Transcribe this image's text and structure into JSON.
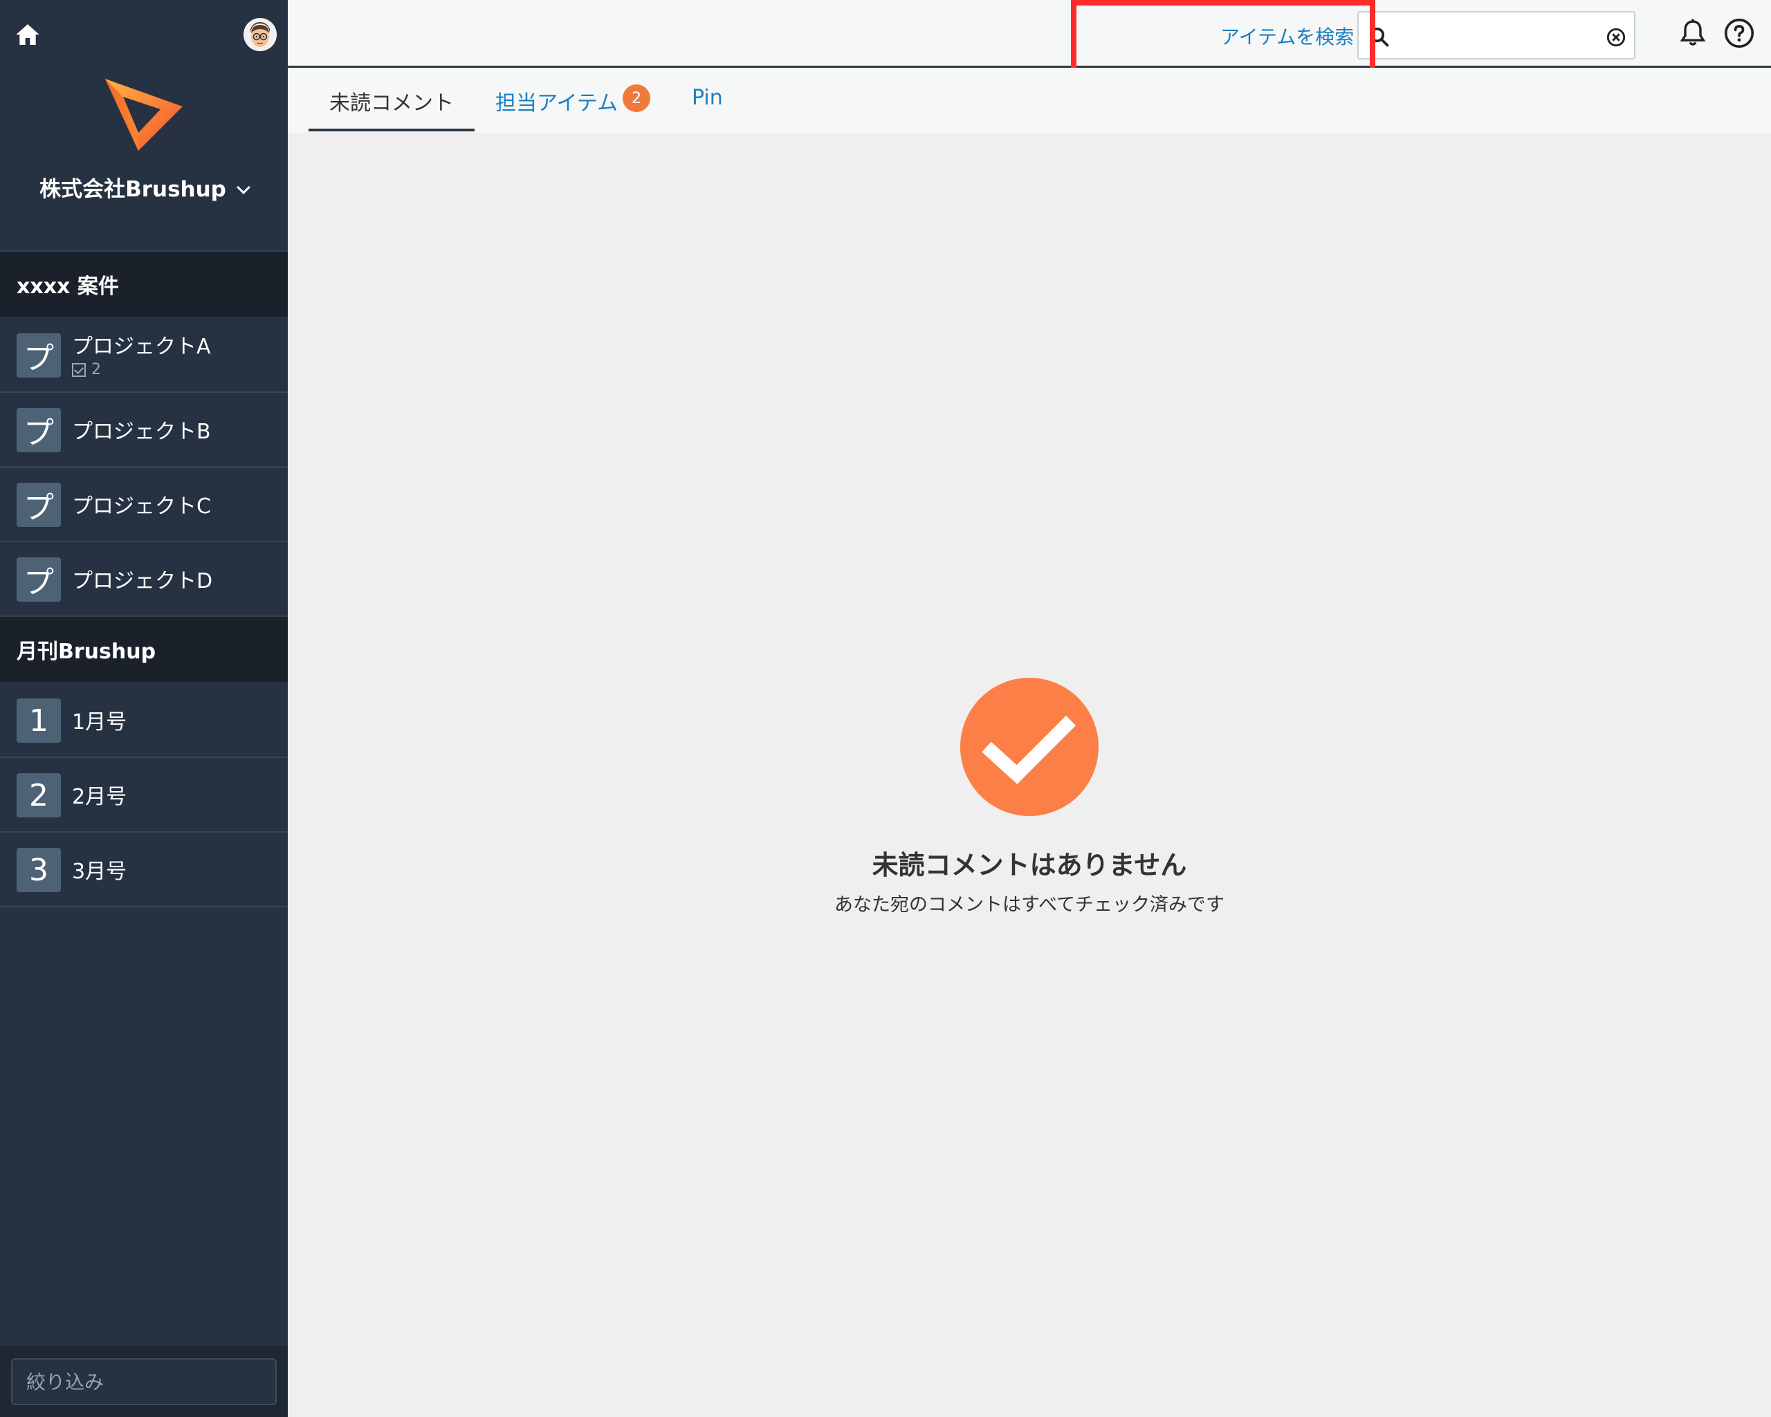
{
  "sidebar": {
    "org_name": "株式会社Brushup",
    "groups": [
      {
        "title": "xxxx 案件",
        "items": [
          {
            "icon": "プ",
            "label": "プロジェクトA",
            "count": "2"
          },
          {
            "icon": "プ",
            "label": "プロジェクトB"
          },
          {
            "icon": "プ",
            "label": "プロジェクトC"
          },
          {
            "icon": "プ",
            "label": "プロジェクトD"
          }
        ]
      },
      {
        "title": "月刊Brushup",
        "items": [
          {
            "icon": "1",
            "label": "1月号"
          },
          {
            "icon": "2",
            "label": "2月号"
          },
          {
            "icon": "3",
            "label": "3月号"
          }
        ]
      }
    ],
    "filter_placeholder": "絞り込み"
  },
  "header": {
    "search_link": "アイテムを検索",
    "search_value": ""
  },
  "tabs": [
    {
      "label": "未読コメント",
      "active": true
    },
    {
      "label": "担当アイテム",
      "badge": "2"
    },
    {
      "label": "Pin"
    }
  ],
  "empty_state": {
    "title": "未読コメントはありません",
    "subtitle": "あなた宛のコメントはすべてチェック済みです"
  },
  "colors": {
    "sidebar_bg": "#263241",
    "accent_orange": "#fd7f48",
    "link_blue": "#1a7fc1",
    "highlight_red": "#ff2a2a"
  }
}
